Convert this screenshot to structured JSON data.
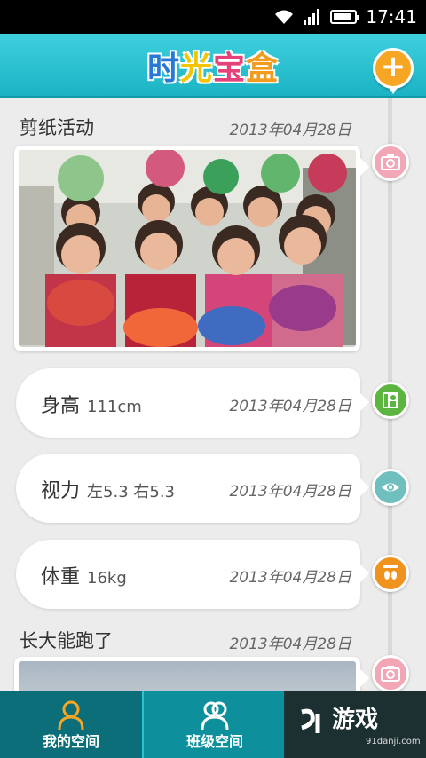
{
  "status_bar": {
    "time": "17:41"
  },
  "header": {
    "logo_chars": [
      "时",
      "光",
      "宝",
      "盒"
    ],
    "logo_colors": [
      "#2a78d6",
      "#f5c400",
      "#e5427a",
      "#f19b1f"
    ]
  },
  "timeline": {
    "entries": [
      {
        "type": "photo",
        "title": "剪纸活动",
        "date": "2013年04月28日",
        "icon": "camera-icon",
        "icon_color": "#f2a6b6"
      },
      {
        "type": "metric",
        "label": "身高",
        "value": "111cm",
        "date": "2013年04月28日",
        "icon": "height-chart-icon",
        "icon_color": "#5cb53f"
      },
      {
        "type": "metric",
        "label": "视力",
        "value": "左5.3 右5.3",
        "date": "2013年04月28日",
        "icon": "eye-icon",
        "icon_color": "#6fbfbf"
      },
      {
        "type": "metric",
        "label": "体重",
        "value": "16kg",
        "date": "2013年04月28日",
        "icon": "footprints-scale-icon",
        "icon_color": "#f0931e"
      },
      {
        "type": "photo",
        "title": "长大能跑了",
        "date": "2013年04月28日",
        "icon": "camera-icon",
        "icon_color": "#f2a6b6"
      }
    ]
  },
  "tabs": [
    {
      "label": "我的空间",
      "icon": "person-icon"
    },
    {
      "label": "班级空间",
      "icon": "people-icon"
    }
  ],
  "watermark": {
    "brand": "游戏",
    "url": "91danji.com"
  }
}
